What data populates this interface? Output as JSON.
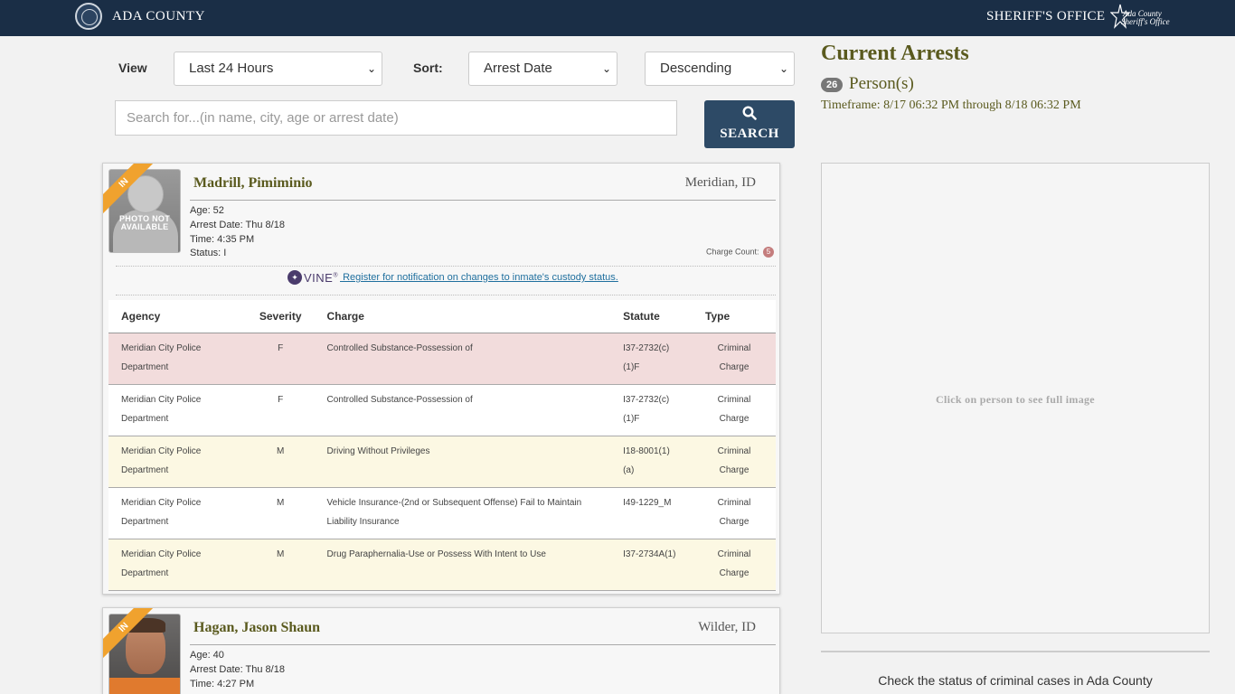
{
  "header": {
    "left_brand": "ADA COUNTY",
    "right_brand": "SHERIFF'S OFFICE",
    "logo_line1": "Ada County",
    "logo_line2": "Sheriff's Office",
    "bar_color": "#1a2e46"
  },
  "filters": {
    "view_label": "View",
    "view_value": "Last 24 Hours",
    "sort_label": "Sort:",
    "sort_value": "Arrest Date",
    "order_value": "Descending",
    "search_placeholder": "Search for...(in name, city, age or arrest date)",
    "search_button": "SEARCH",
    "search_icon": "search-icon"
  },
  "summary": {
    "title": "Current Arrests",
    "count": "26",
    "count_label": "Person(s)",
    "timeframe": "Timeframe: 8/17 06:32 PM through 8/18 06:32 PM",
    "image_placeholder": "Click on person to see full image",
    "check_status": "Check the status of criminal cases in Ada County"
  },
  "vine": {
    "logo_text": "VINE",
    "link_text": " Register for notification on changes to inmate's custody status."
  },
  "table_headers": {
    "agency": "Agency",
    "severity": "Severity",
    "charge": "Charge",
    "statute": "Statute",
    "type": "Type"
  },
  "persons": [
    {
      "badge": "IN",
      "name": "Madrill, Pimiminio",
      "city": "Meridian, ID",
      "age": "Age: 52",
      "arrest_date": "Arrest Date: Thu 8/18",
      "time": "Time: 4:35 PM",
      "status": "Status: I",
      "charge_count_label": "Charge Count:",
      "charge_count": "5",
      "photo_text": "PHOTO NOT AVAILABLE",
      "charges": [
        {
          "agency": "Meridian City Police Department",
          "severity": "F",
          "charge": "Controlled Substance-Possession of",
          "statute": "I37-2732(c)(1)F",
          "type": "Criminal Charge"
        },
        {
          "agency": "Meridian City Police Department",
          "severity": "F",
          "charge": "Controlled Substance-Possession of",
          "statute": "I37-2732(c)(1)F",
          "type": "Criminal Charge"
        },
        {
          "agency": "Meridian City Police Department",
          "severity": "M",
          "charge": "Driving Without Privileges",
          "statute": "I18-8001(1)(a)",
          "type": "Criminal Charge"
        },
        {
          "agency": "Meridian City Police Department",
          "severity": "M",
          "charge": "Vehicle Insurance-(2nd or Subsequent Offense) Fail to Maintain Liability Insurance",
          "statute": "I49-1229_M",
          "type": "Criminal Charge"
        },
        {
          "agency": "Meridian City Police Department",
          "severity": "M",
          "charge": "Drug Paraphernalia-Use or Possess With Intent to Use",
          "statute": "I37-2734A(1)",
          "type": "Criminal Charge"
        }
      ]
    },
    {
      "badge": "IN",
      "name": "Hagan, Jason Shaun",
      "city": "Wilder, ID",
      "age": "Age: 40",
      "arrest_date": "Arrest Date: Thu 8/18",
      "time": "Time: 4:27 PM"
    }
  ],
  "colors": {
    "felony_row": "#f2dcdc",
    "misdemeanor_row": "#fcf8e3",
    "olive_text": "#5a5a1e",
    "ribbon": "#f0a22e",
    "button": "#2d4a66"
  }
}
